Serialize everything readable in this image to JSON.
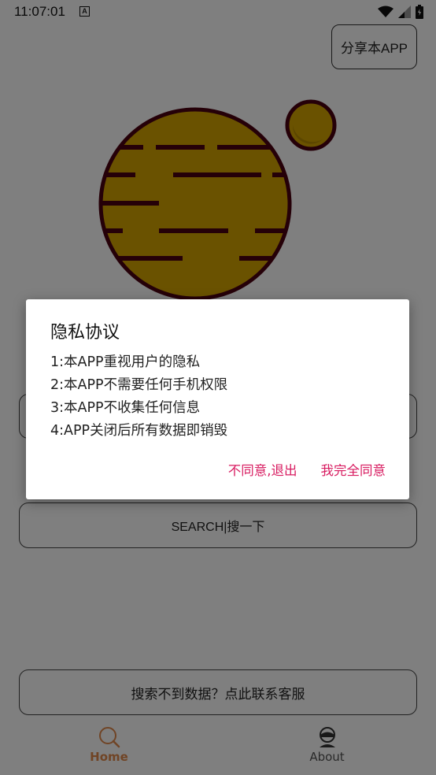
{
  "status_bar": {
    "time": "11:07:01",
    "notification_icon": "A"
  },
  "share_button": {
    "label": "分享本APP"
  },
  "main": {
    "hidden_button_label": "",
    "search_button_label": "SEARCH|搜一下",
    "contact_button_label": "搜索不到数据？点此联系客服"
  },
  "bottom_nav": {
    "items": [
      {
        "label": "Home",
        "icon": "search-icon",
        "active": true
      },
      {
        "label": "About",
        "icon": "user-icon",
        "active": false
      }
    ]
  },
  "dialog": {
    "title": "隐私协议",
    "lines": [
      "1:本APP重视用户的隐私",
      "2:本APP不需要任何手机权限",
      "3:本APP不收集任何信息",
      "4:APP关闭后所有数据即销毁"
    ],
    "decline_label": "不同意,退出",
    "accept_label": "我完全同意"
  },
  "colors": {
    "accent": "#e0894a",
    "dialog_action": "#d81b60",
    "planet_fill": "#d4a400",
    "planet_stroke": "#4a0010"
  }
}
